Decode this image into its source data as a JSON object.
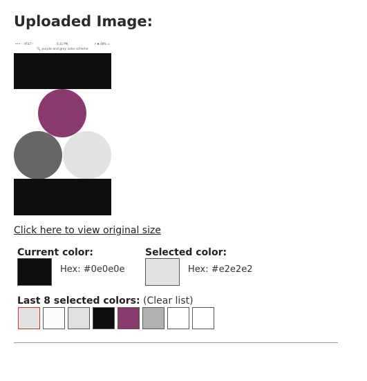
{
  "heading": "Uploaded Image:",
  "image": {
    "status_carrier": "•••◦◦ AT&T ᵖ",
    "status_time": "6:31 PM",
    "status_battery": "↗ ✱ 48% ▭",
    "search_text": "🔍 purple and grey color scheme",
    "colors": {
      "background": "#ffffff",
      "bands": "#0e0e0e",
      "purple": "#8b3a6e",
      "dark_grey": "#666666",
      "light_grey": "#e2e2e2"
    }
  },
  "view_link": "Click here to view original size",
  "current": {
    "label": "Current color:",
    "hex_label": "Hex:",
    "hex_value": "#0e0e0e",
    "color": "#0e0e0e"
  },
  "selected": {
    "label": "Selected color:",
    "hex_label": "Hex:",
    "hex_value": "#e2e2e2",
    "color": "#e2e2e2"
  },
  "last_selected": {
    "label": "Last 8 selected colors:",
    "clear_text": "(Clear list)",
    "colors": [
      "#e2e2e2",
      "#fcfcfc",
      "#e0e0e0",
      "#0e0e0e",
      "#8b3a6e",
      "#b2b2b2",
      "#ffffff",
      "#ffffff"
    ]
  }
}
